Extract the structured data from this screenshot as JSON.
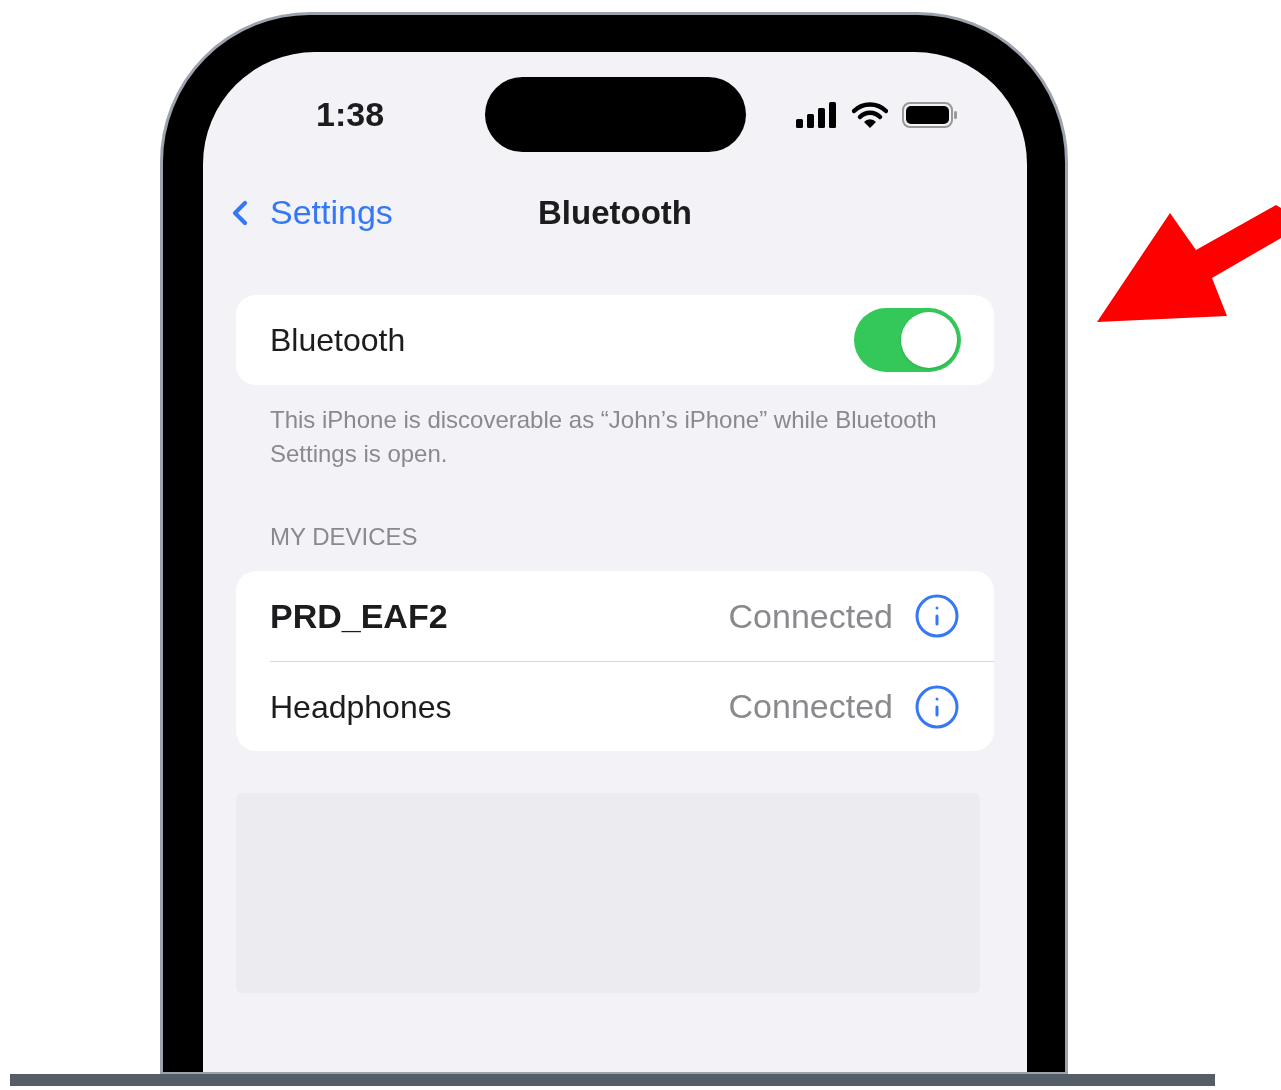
{
  "status_bar": {
    "time": "1:38"
  },
  "nav": {
    "back": "Settings",
    "title": "Bluetooth"
  },
  "bluetooth": {
    "label": "Bluetooth",
    "on": true
  },
  "footer": "This iPhone is discoverable as “John’s iPhone” while Bluetooth Settings is open.",
  "section_header": "MY DEVICES",
  "devices": [
    {
      "name": "PRD_EAF2",
      "status": "Connected",
      "emphasized": true
    },
    {
      "name": "Headphones",
      "status": "Connected",
      "emphasized": false
    }
  ]
}
